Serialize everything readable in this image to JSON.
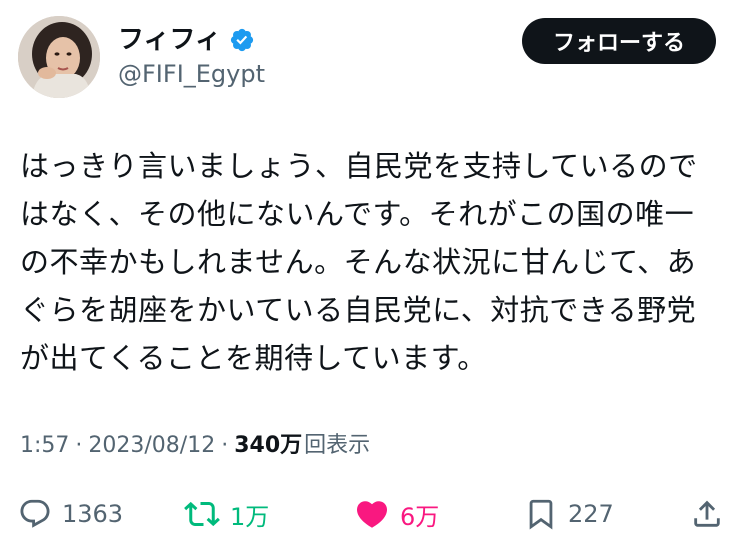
{
  "user": {
    "display_name": "フィフィ",
    "handle": "@FIFI_Egypt",
    "verified_icon": "verified-badge-icon"
  },
  "follow_button_label": "フォローする",
  "tweet": {
    "lines": [
      "はっきり言いましょう、自民党を支持しているので",
      "はなく、その他にないんです。それがこの国の唯一",
      "の不幸かもしれません。そんな状況に甘んじて、あ",
      "ぐらを胡座をかいている自民党に、対抗できる野党",
      "が出てくることを期待しています。"
    ]
  },
  "meta": {
    "time": "1:57",
    "separator": "·",
    "date": "2023/08/12",
    "views_count": "340万",
    "views_label": "回表示"
  },
  "actions": {
    "reply_count": "1363",
    "retweet_count": "1万",
    "like_count": "6万",
    "bookmark_count": "227"
  },
  "colors": {
    "text": "#0f1419",
    "secondary": "#536471",
    "retweet": "#00ba7c",
    "like": "#f91880",
    "verified": "#1d9bf0",
    "button": "#0f1419"
  }
}
